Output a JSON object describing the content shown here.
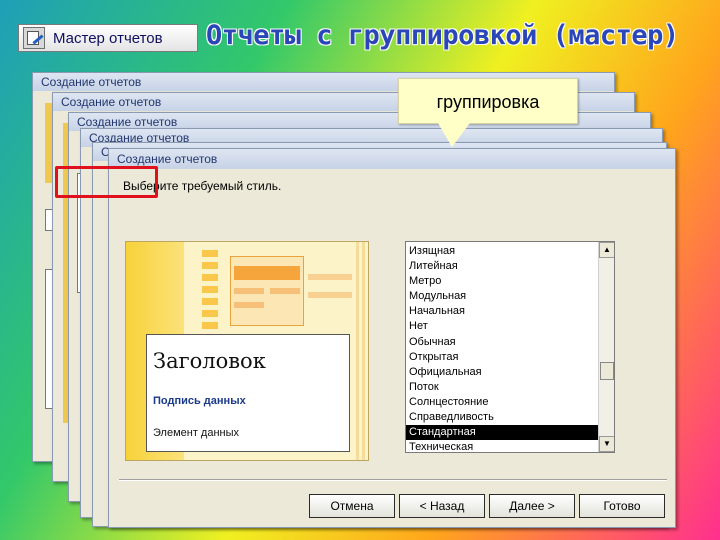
{
  "wizard_button": {
    "label": "Мастер отчетов",
    "icon": "report-wizard-icon"
  },
  "slide": {
    "title": "Отчеты с группировкой (мастер)"
  },
  "dialogs": {
    "title": "Создание отчетов"
  },
  "main_dialog": {
    "title": "Создание отчетов",
    "prompt": "Выберите требуемый стиль.",
    "preview": {
      "heading": "Заголовок",
      "data_label": "Подпись данных",
      "data_element": "Элемент данных"
    },
    "styles": [
      "Изящная",
      "Литейная",
      "Метро",
      "Модульная",
      "Начальная",
      "Нет",
      "Обычная",
      "Открытая",
      "Официальная",
      "Поток",
      "Солнцестояние",
      "Справедливость",
      "Стандартная",
      "Техническая"
    ],
    "selected_style": "Стандартная",
    "buttons": {
      "cancel": "Отмена",
      "back": "< Назад",
      "next": "Далее >",
      "finish": "Готово"
    }
  },
  "callout": {
    "text": "группировка"
  },
  "colors": {
    "highlight": "#e0101c",
    "callout_bg": "#ffffc8",
    "title": "#2a46b8"
  }
}
